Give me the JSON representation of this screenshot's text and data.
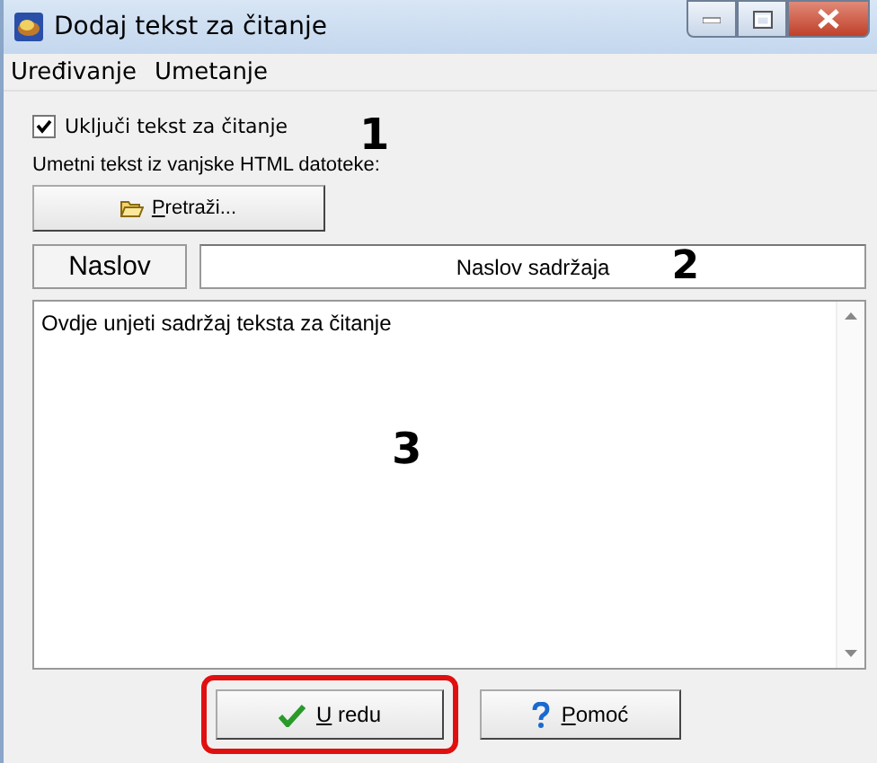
{
  "window": {
    "title": "Dodaj tekst za čitanje"
  },
  "menu": [
    {
      "label": "Uređivanje"
    },
    {
      "label": "Umetanje"
    }
  ],
  "enable_checkbox": {
    "label": "Uključi tekst za čitanje",
    "checked": true
  },
  "import_label": "Umetni tekst iz vanjske HTML datoteke:",
  "browse_button": {
    "label": "Pretraži...",
    "mnemonic_underlined": true
  },
  "title_row": {
    "label": "Naslov",
    "value": "Naslov sadržaja"
  },
  "content": {
    "value": "Ovdje unjeti sadržaj teksta za čitanje"
  },
  "buttons": [
    {
      "kind": "ok",
      "label": "U redu",
      "mnemonic_underlined": true,
      "highlighted": true
    },
    {
      "kind": "help",
      "label": "Pomoć",
      "mnemonic_underlined": true,
      "highlighted": false
    }
  ],
  "annotations": [
    "1",
    "2",
    "3"
  ]
}
